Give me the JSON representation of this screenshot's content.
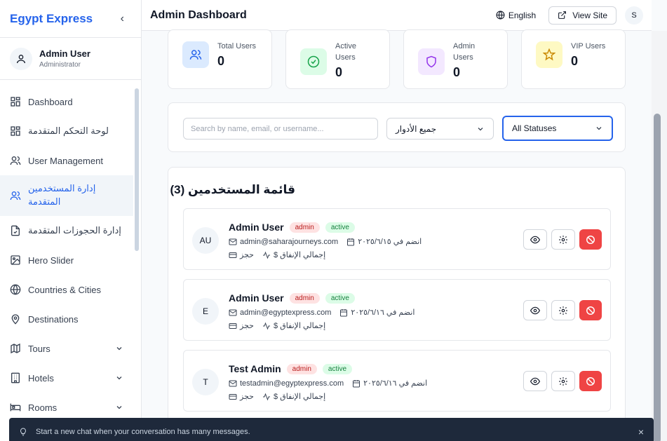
{
  "sidebar": {
    "brand": "Egypt Express",
    "profile": {
      "name": "Admin User",
      "role": "Administrator"
    },
    "items": [
      {
        "label": "Dashboard",
        "icon": "grid-icon"
      },
      {
        "label": "لوحة التحكم المتقدمة",
        "icon": "grid-icon"
      },
      {
        "label": "User Management",
        "icon": "users-icon"
      },
      {
        "label": "إدارة المستخدمين المتقدمة",
        "icon": "users-icon",
        "active": true
      },
      {
        "label": "إدارة الحجوزات المتقدمة",
        "icon": "file-check-icon"
      },
      {
        "label": "Hero Slider",
        "icon": "image-icon"
      },
      {
        "label": "Countries & Cities",
        "icon": "globe-icon"
      },
      {
        "label": "Destinations",
        "icon": "map-pin-icon"
      },
      {
        "label": "Tours",
        "icon": "map-icon",
        "expandable": true
      },
      {
        "label": "Hotels",
        "icon": "building-icon",
        "expandable": true
      },
      {
        "label": "Rooms",
        "icon": "bed-icon",
        "expandable": true
      }
    ]
  },
  "header": {
    "title": "Admin Dashboard",
    "language": "English",
    "view_site": "View Site",
    "user_initial": "S"
  },
  "stats": [
    {
      "label": "Total Users",
      "value": "0",
      "icon": "users-icon",
      "color": "#2563eb",
      "bg": "#dbeafe"
    },
    {
      "label": "Active Users",
      "value": "0",
      "icon": "check-circle-icon",
      "color": "#16a34a",
      "bg": "#dcfce7"
    },
    {
      "label": "Admin Users",
      "value": "0",
      "icon": "shield-icon",
      "color": "#9333ea",
      "bg": "#f3e8ff"
    },
    {
      "label": "VIP Users",
      "value": "0",
      "icon": "star-icon",
      "color": "#ca8a04",
      "bg": "#fef9c3"
    }
  ],
  "filters": {
    "search_placeholder": "Search by name, email, or username...",
    "role_select": "جميع الأدوار",
    "status_select": "All Statuses"
  },
  "list": {
    "title": "قائمة المستخدمين (3)",
    "users": [
      {
        "initials": "AU",
        "name": "Admin User",
        "role": "admin",
        "status": "active",
        "email": "admin@saharajourneys.com",
        "joined": "انضم في ٢٠٢٥/٦/١٥",
        "bookings": "حجز",
        "spend": "إجمالي الإنفاق $"
      },
      {
        "initials": "E",
        "name": "Admin User",
        "role": "admin",
        "status": "active",
        "email": "admin@egyptexpress.com",
        "joined": "انضم في ٢٠٢٥/٦/١٦",
        "bookings": "حجز",
        "spend": "إجمالي الإنفاق $"
      },
      {
        "initials": "T",
        "name": "Test Admin",
        "role": "admin",
        "status": "active",
        "email": "testadmin@egyptexpress.com",
        "joined": "انضم في ٢٠٢٥/٦/١٦",
        "bookings": "حجز",
        "spend": "إجمالي الإنفاق $"
      }
    ]
  },
  "toast": {
    "message": "Start a new chat when your conversation has many messages.",
    "close": "×"
  },
  "colors": {
    "accent": "#2563eb",
    "danger": "#ef4444"
  }
}
